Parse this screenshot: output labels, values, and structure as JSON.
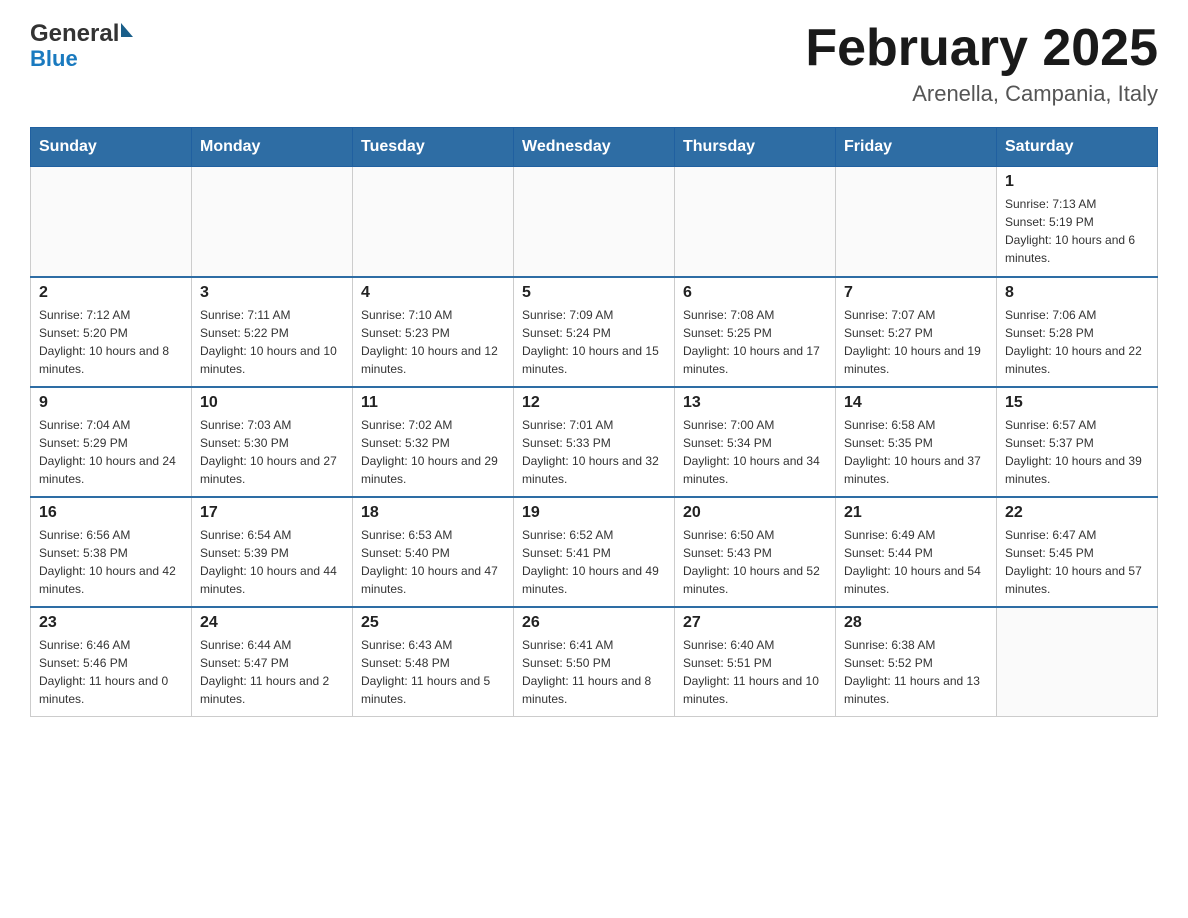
{
  "header": {
    "logo_general": "General",
    "logo_blue": "Blue",
    "title": "February 2025",
    "subtitle": "Arenella, Campania, Italy"
  },
  "days_of_week": [
    "Sunday",
    "Monday",
    "Tuesday",
    "Wednesday",
    "Thursday",
    "Friday",
    "Saturday"
  ],
  "weeks": [
    {
      "days": [
        {
          "date": "",
          "info": ""
        },
        {
          "date": "",
          "info": ""
        },
        {
          "date": "",
          "info": ""
        },
        {
          "date": "",
          "info": ""
        },
        {
          "date": "",
          "info": ""
        },
        {
          "date": "",
          "info": ""
        },
        {
          "date": "1",
          "info": "Sunrise: 7:13 AM\nSunset: 5:19 PM\nDaylight: 10 hours and 6 minutes."
        }
      ]
    },
    {
      "days": [
        {
          "date": "2",
          "info": "Sunrise: 7:12 AM\nSunset: 5:20 PM\nDaylight: 10 hours and 8 minutes."
        },
        {
          "date": "3",
          "info": "Sunrise: 7:11 AM\nSunset: 5:22 PM\nDaylight: 10 hours and 10 minutes."
        },
        {
          "date": "4",
          "info": "Sunrise: 7:10 AM\nSunset: 5:23 PM\nDaylight: 10 hours and 12 minutes."
        },
        {
          "date": "5",
          "info": "Sunrise: 7:09 AM\nSunset: 5:24 PM\nDaylight: 10 hours and 15 minutes."
        },
        {
          "date": "6",
          "info": "Sunrise: 7:08 AM\nSunset: 5:25 PM\nDaylight: 10 hours and 17 minutes."
        },
        {
          "date": "7",
          "info": "Sunrise: 7:07 AM\nSunset: 5:27 PM\nDaylight: 10 hours and 19 minutes."
        },
        {
          "date": "8",
          "info": "Sunrise: 7:06 AM\nSunset: 5:28 PM\nDaylight: 10 hours and 22 minutes."
        }
      ]
    },
    {
      "days": [
        {
          "date": "9",
          "info": "Sunrise: 7:04 AM\nSunset: 5:29 PM\nDaylight: 10 hours and 24 minutes."
        },
        {
          "date": "10",
          "info": "Sunrise: 7:03 AM\nSunset: 5:30 PM\nDaylight: 10 hours and 27 minutes."
        },
        {
          "date": "11",
          "info": "Sunrise: 7:02 AM\nSunset: 5:32 PM\nDaylight: 10 hours and 29 minutes."
        },
        {
          "date": "12",
          "info": "Sunrise: 7:01 AM\nSunset: 5:33 PM\nDaylight: 10 hours and 32 minutes."
        },
        {
          "date": "13",
          "info": "Sunrise: 7:00 AM\nSunset: 5:34 PM\nDaylight: 10 hours and 34 minutes."
        },
        {
          "date": "14",
          "info": "Sunrise: 6:58 AM\nSunset: 5:35 PM\nDaylight: 10 hours and 37 minutes."
        },
        {
          "date": "15",
          "info": "Sunrise: 6:57 AM\nSunset: 5:37 PM\nDaylight: 10 hours and 39 minutes."
        }
      ]
    },
    {
      "days": [
        {
          "date": "16",
          "info": "Sunrise: 6:56 AM\nSunset: 5:38 PM\nDaylight: 10 hours and 42 minutes."
        },
        {
          "date": "17",
          "info": "Sunrise: 6:54 AM\nSunset: 5:39 PM\nDaylight: 10 hours and 44 minutes."
        },
        {
          "date": "18",
          "info": "Sunrise: 6:53 AM\nSunset: 5:40 PM\nDaylight: 10 hours and 47 minutes."
        },
        {
          "date": "19",
          "info": "Sunrise: 6:52 AM\nSunset: 5:41 PM\nDaylight: 10 hours and 49 minutes."
        },
        {
          "date": "20",
          "info": "Sunrise: 6:50 AM\nSunset: 5:43 PM\nDaylight: 10 hours and 52 minutes."
        },
        {
          "date": "21",
          "info": "Sunrise: 6:49 AM\nSunset: 5:44 PM\nDaylight: 10 hours and 54 minutes."
        },
        {
          "date": "22",
          "info": "Sunrise: 6:47 AM\nSunset: 5:45 PM\nDaylight: 10 hours and 57 minutes."
        }
      ]
    },
    {
      "days": [
        {
          "date": "23",
          "info": "Sunrise: 6:46 AM\nSunset: 5:46 PM\nDaylight: 11 hours and 0 minutes."
        },
        {
          "date": "24",
          "info": "Sunrise: 6:44 AM\nSunset: 5:47 PM\nDaylight: 11 hours and 2 minutes."
        },
        {
          "date": "25",
          "info": "Sunrise: 6:43 AM\nSunset: 5:48 PM\nDaylight: 11 hours and 5 minutes."
        },
        {
          "date": "26",
          "info": "Sunrise: 6:41 AM\nSunset: 5:50 PM\nDaylight: 11 hours and 8 minutes."
        },
        {
          "date": "27",
          "info": "Sunrise: 6:40 AM\nSunset: 5:51 PM\nDaylight: 11 hours and 10 minutes."
        },
        {
          "date": "28",
          "info": "Sunrise: 6:38 AM\nSunset: 5:52 PM\nDaylight: 11 hours and 13 minutes."
        },
        {
          "date": "",
          "info": ""
        }
      ]
    }
  ]
}
